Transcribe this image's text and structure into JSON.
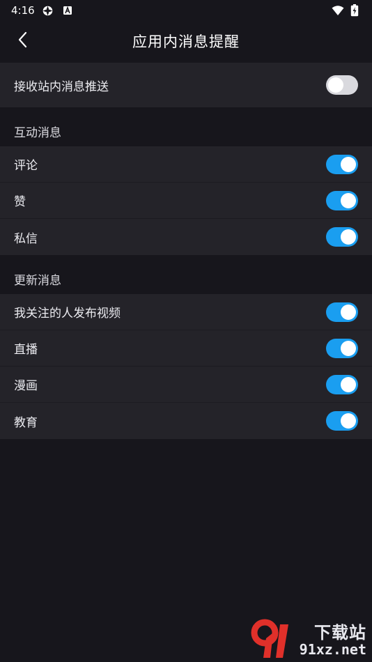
{
  "status_bar": {
    "time": "4:16",
    "icons": [
      "settings-gear-icon",
      "a-box-icon",
      "wifi-icon",
      "battery-charging-icon"
    ]
  },
  "header": {
    "title": "应用内消息提醒",
    "back_icon": "chevron-left-icon"
  },
  "master": {
    "label": "接收站内消息推送",
    "enabled": false
  },
  "sections": [
    {
      "title": "互动消息",
      "items": [
        {
          "label": "评论",
          "enabled": true
        },
        {
          "label": "赞",
          "enabled": true
        },
        {
          "label": "私信",
          "enabled": true
        }
      ]
    },
    {
      "title": "更新消息",
      "items": [
        {
          "label": "我关注的人发布视频",
          "enabled": true
        },
        {
          "label": "直播",
          "enabled": true
        },
        {
          "label": "漫画",
          "enabled": true
        },
        {
          "label": "教育",
          "enabled": true
        }
      ]
    }
  ],
  "watermark": {
    "logo_text": "91",
    "line1": "下载站",
    "line2": "91xz.net"
  },
  "colors": {
    "background": "#17161c",
    "card": "#242329",
    "toggle_on": "#1a9ef0",
    "toggle_off": "#d9d9de",
    "logo_red": "#e0302a"
  }
}
